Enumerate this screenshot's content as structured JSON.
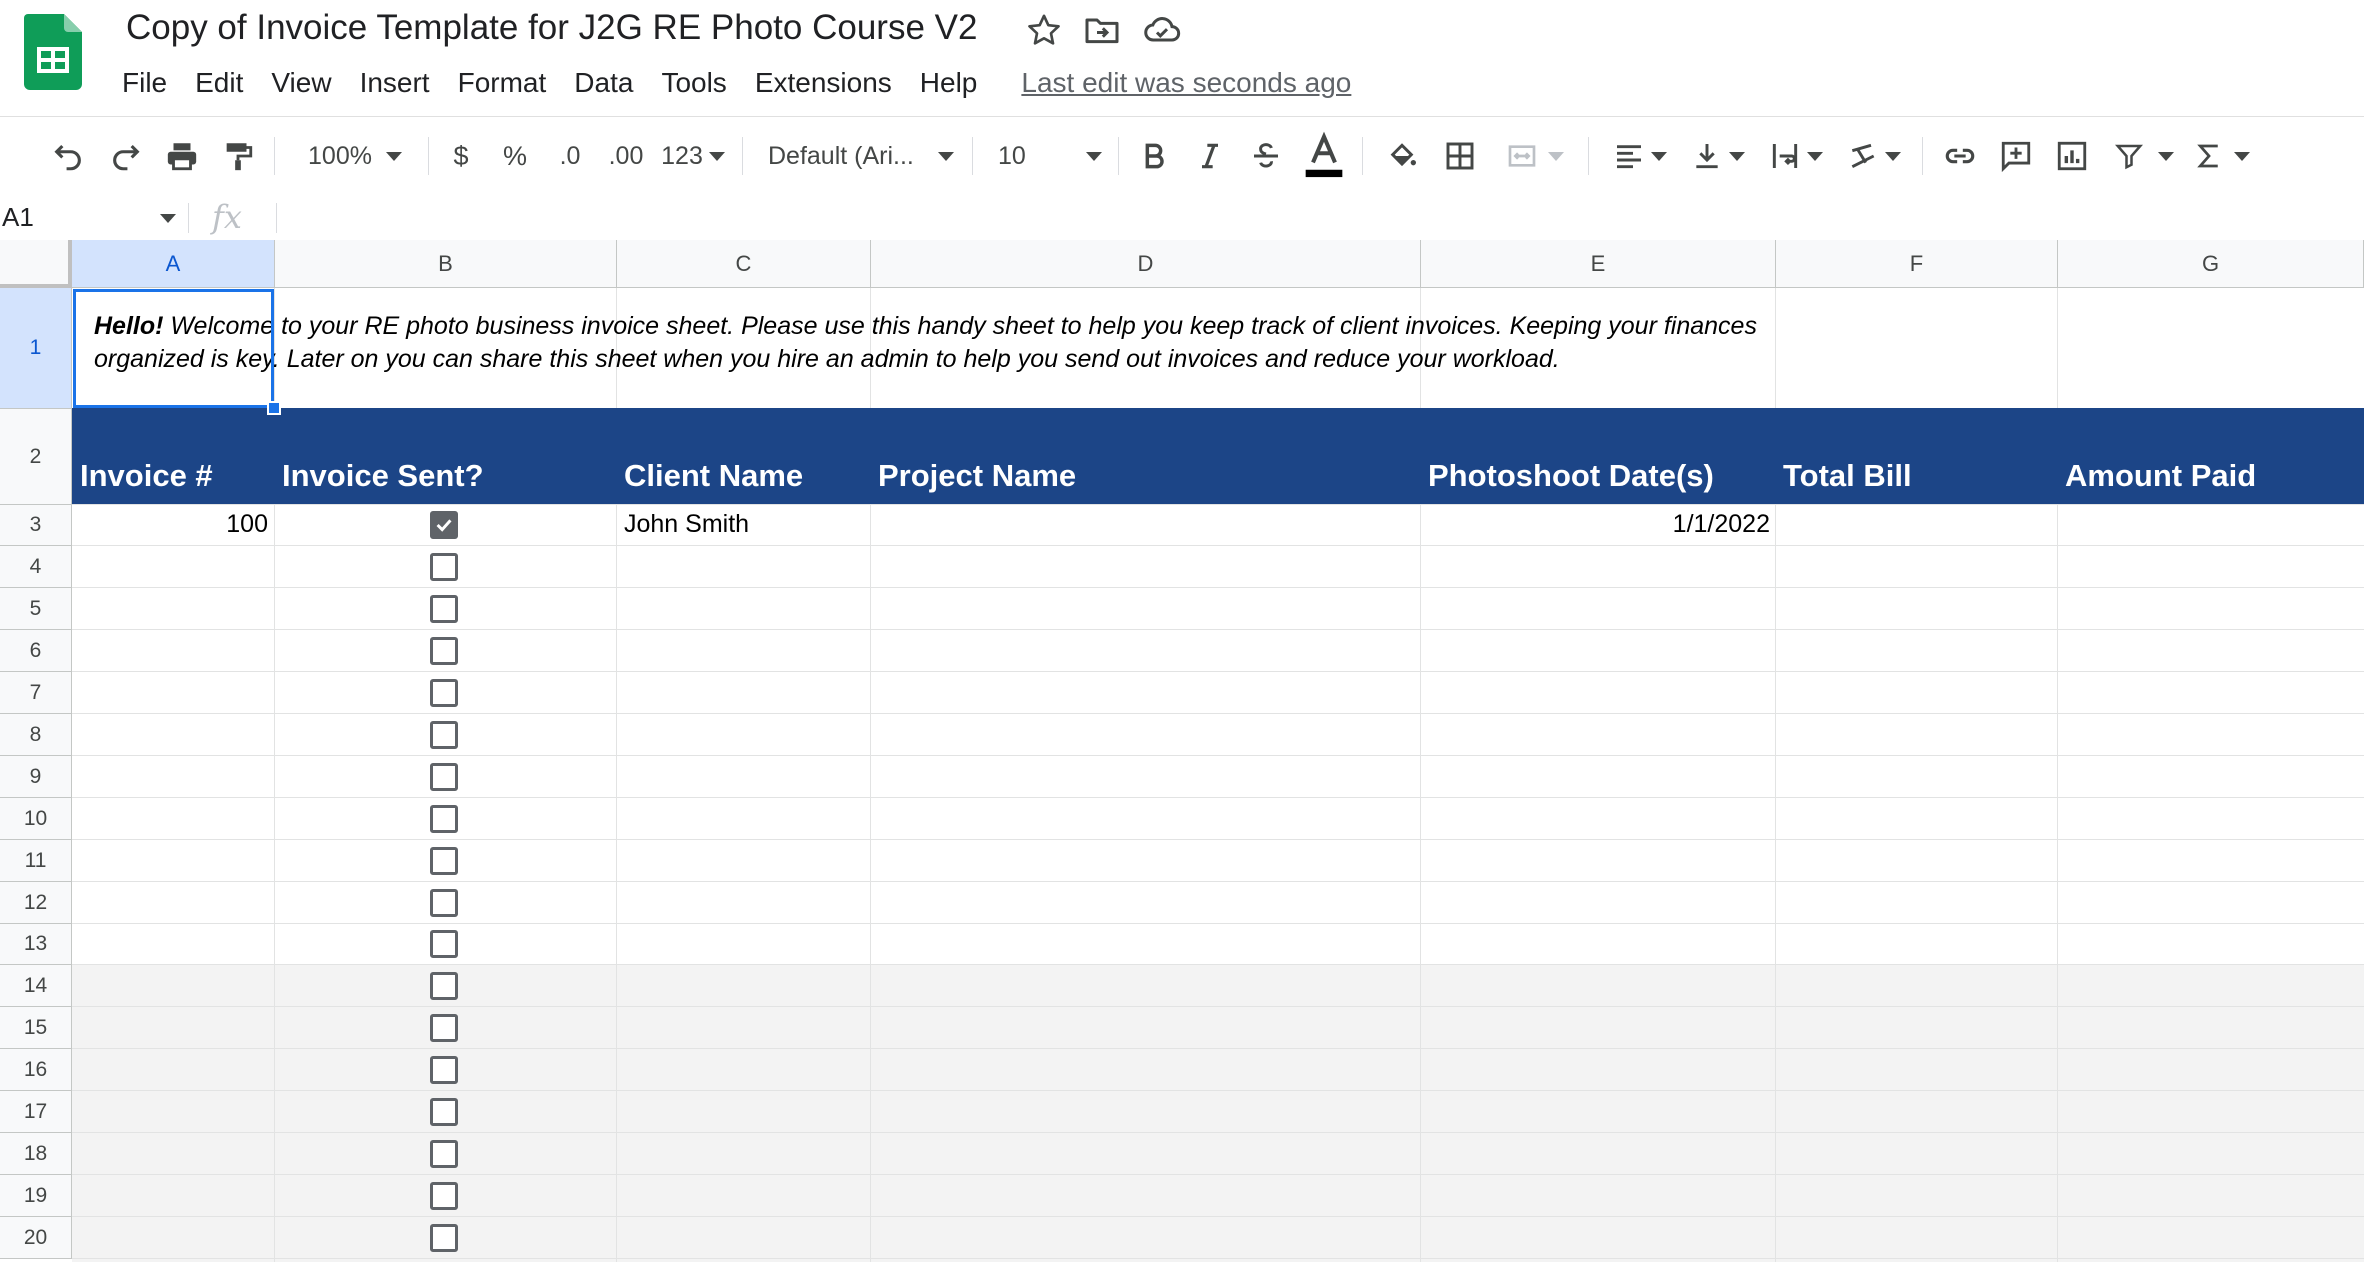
{
  "app": {
    "title": "Copy of Invoice Template for J2G RE Photo Course V2",
    "menu": [
      "File",
      "Edit",
      "View",
      "Insert",
      "Format",
      "Data",
      "Tools",
      "Extensions",
      "Help"
    ],
    "last_edit": "Last edit was seconds ago"
  },
  "toolbar": {
    "zoom": "100%",
    "currency": "$",
    "percent": "%",
    "decrease_decimal": ".0",
    "increase_decimal": ".00",
    "more_formats": "123",
    "font": "Default (Ari...",
    "font_size": "10"
  },
  "formula_bar": {
    "cell_ref": "A1",
    "fx": "fx",
    "value": ""
  },
  "columns": [
    "A",
    "B",
    "C",
    "D",
    "E",
    "F",
    "G"
  ],
  "rows": [
    "1",
    "2",
    "3",
    "4",
    "5",
    "6",
    "7",
    "8",
    "9",
    "10",
    "11",
    "12",
    "13",
    "14",
    "15",
    "16",
    "17",
    "18",
    "19",
    "20"
  ],
  "sheet": {
    "intro_bold": "Hello!",
    "intro_line1": " Welcome to your RE photo business invoice sheet. Please use this handy sheet to help you keep track of client invoices. Keeping your finances",
    "intro_line2": "organized is key. Later on you can share this sheet when you hire an admin to help you send out invoices and reduce your workload.",
    "headers": [
      "Invoice  #",
      "Invoice Sent?",
      "Client Name",
      "Project Name",
      "Photoshoot Date(s)",
      "Total Bill",
      "Amount Paid"
    ],
    "rows": [
      {
        "invoice": "100",
        "sent": true,
        "client": "John Smith",
        "project": "",
        "date": "1/1/2022",
        "total": "",
        "paid": ""
      }
    ],
    "checkbox_states": [
      true,
      false,
      false,
      false,
      false,
      false,
      false,
      false,
      false,
      false,
      false,
      false,
      false,
      false,
      false,
      false,
      false,
      false
    ],
    "header_band_color": "#1c4587",
    "selection_color": "#1a73e8",
    "shaded_row_color": "#f3f3f3"
  },
  "icons": [
    "sheets-logo-icon",
    "star-icon",
    "move-to-folder-icon",
    "cloud-saved-icon",
    "undo-icon",
    "redo-icon",
    "print-icon",
    "paint-format-icon",
    "bold-icon",
    "italic-icon",
    "strikethrough-icon",
    "text-color-icon",
    "fill-color-icon",
    "borders-icon",
    "merge-cells-icon",
    "horizontal-align-icon",
    "vertical-align-icon",
    "text-wrap-icon",
    "text-rotation-icon",
    "insert-link-icon",
    "insert-comment-icon",
    "insert-chart-icon",
    "filter-icon",
    "functions-icon"
  ]
}
